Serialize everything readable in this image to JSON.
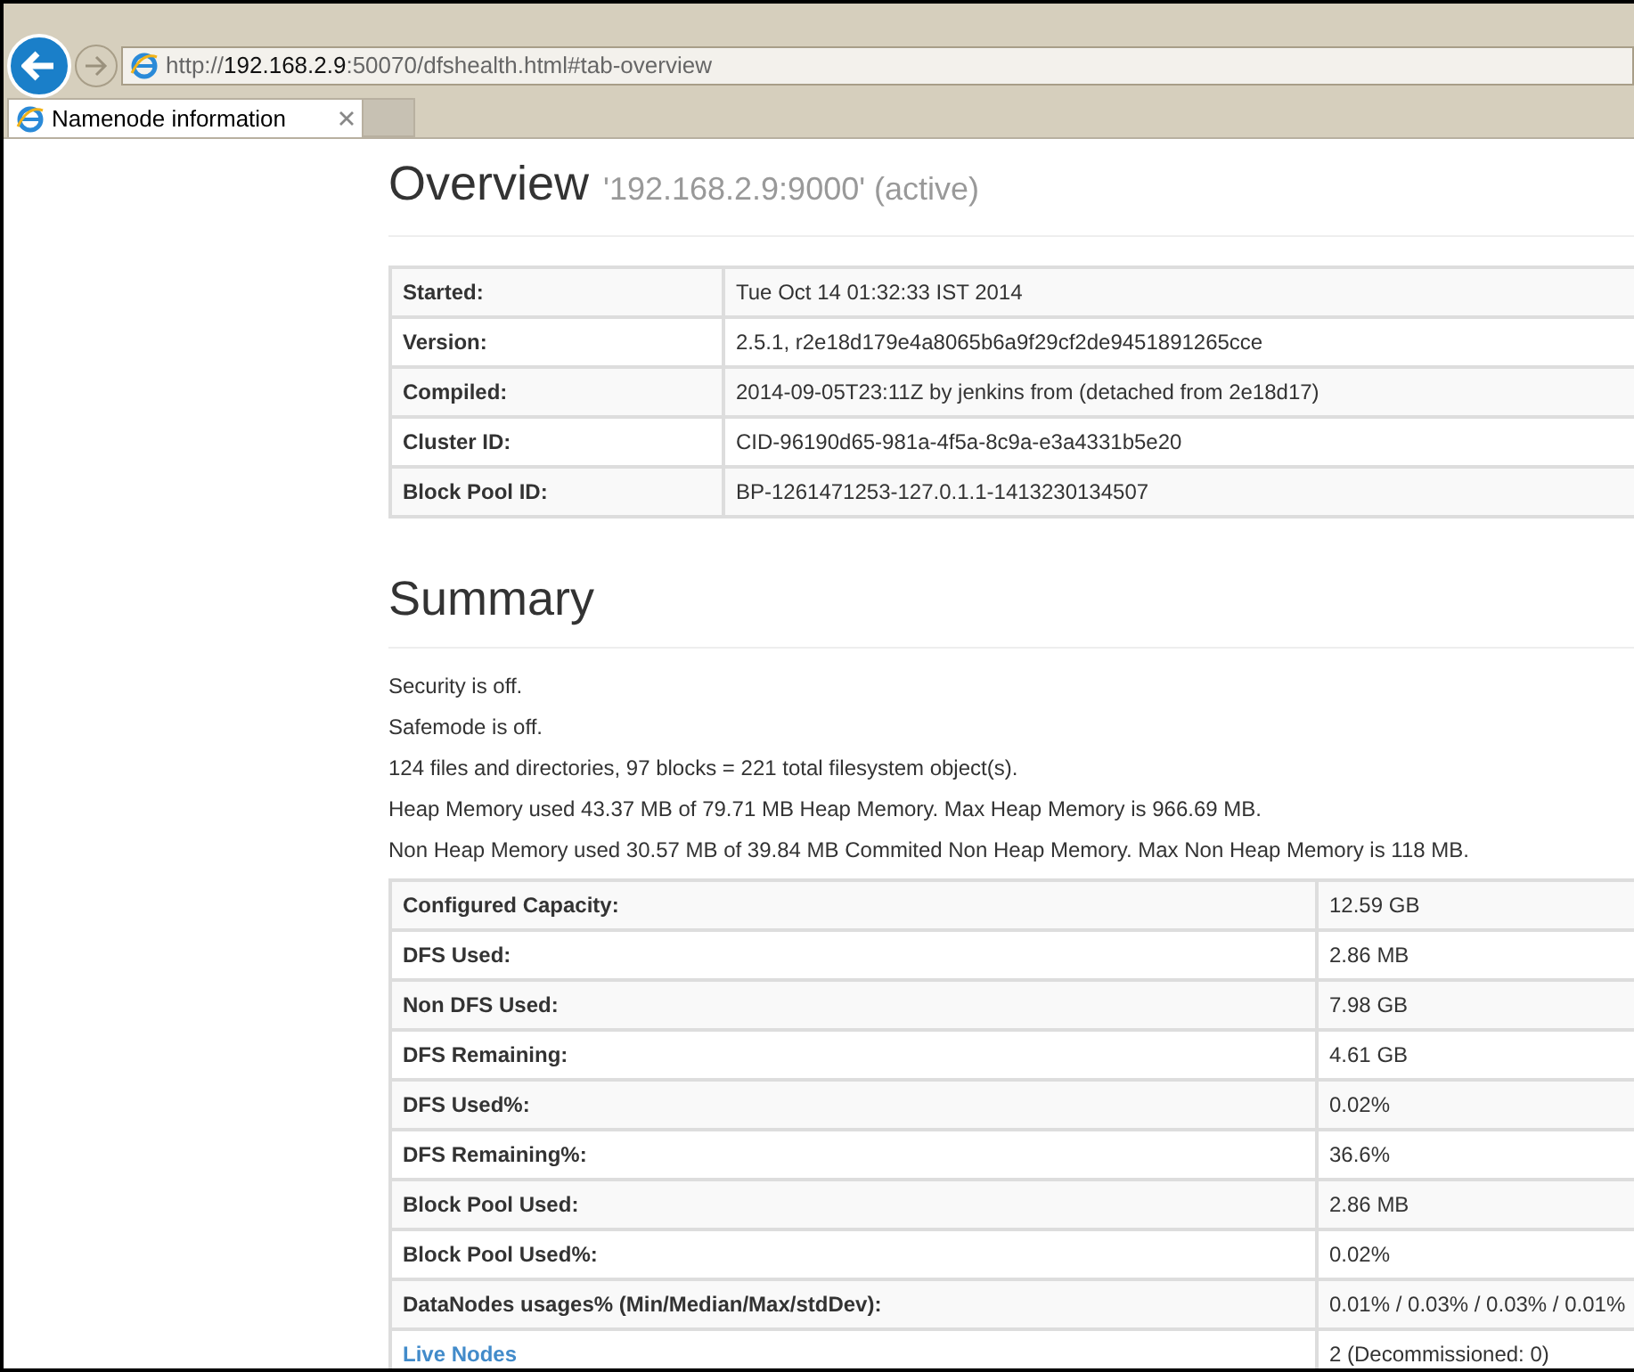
{
  "browser": {
    "address": {
      "scheme": "http://",
      "host": "192.168.2.9",
      "rest": ":50070/dfshealth.html#tab-overview"
    },
    "tabs": [
      {
        "label": "Namenode information",
        "selected": true
      }
    ]
  },
  "overview": {
    "title": "Overview",
    "subtitle": "'192.168.2.9:9000' (active)",
    "rows": [
      {
        "label": "Started:",
        "value": "Tue Oct 14 01:32:33 IST 2014"
      },
      {
        "label": "Version:",
        "value": "2.5.1, r2e18d179e4a8065b6a9f29cf2de9451891265cce"
      },
      {
        "label": "Compiled:",
        "value": "2014-09-05T23:11Z by jenkins from (detached from 2e18d17)"
      },
      {
        "label": "Cluster ID:",
        "value": "CID-96190d65-981a-4f5a-8c9a-e3a4331b5e20"
      },
      {
        "label": "Block Pool ID:",
        "value": "BP-1261471253-127.0.1.1-1413230134507"
      }
    ]
  },
  "summary": {
    "title": "Summary",
    "lines": [
      "Security is off.",
      "Safemode is off.",
      "124 files and directories, 97 blocks = 221 total filesystem object(s).",
      "Heap Memory used 43.37 MB of 79.71 MB Heap Memory. Max Heap Memory is 966.69 MB.",
      "Non Heap Memory used 30.57 MB of 39.84 MB Commited Non Heap Memory. Max Non Heap Memory is 118 MB."
    ],
    "rows": [
      {
        "kind": "text",
        "label": "Configured Capacity:",
        "value": "12.59 GB"
      },
      {
        "kind": "text",
        "label": "DFS Used:",
        "value": "2.86 MB"
      },
      {
        "kind": "text",
        "label": "Non DFS Used:",
        "value": "7.98 GB"
      },
      {
        "kind": "text",
        "label": "DFS Remaining:",
        "value": "4.61 GB"
      },
      {
        "kind": "text",
        "label": "DFS Used%:",
        "value": "0.02%"
      },
      {
        "kind": "text",
        "label": "DFS Remaining%:",
        "value": "36.6%"
      },
      {
        "kind": "text",
        "label": "Block Pool Used:",
        "value": "2.86 MB"
      },
      {
        "kind": "text",
        "label": "Block Pool Used%:",
        "value": "0.02%"
      },
      {
        "kind": "text",
        "label": "DataNodes usages% (Min/Median/Max/stdDev):",
        "value": "0.01% / 0.03% / 0.03% / 0.01%"
      },
      {
        "kind": "link",
        "label": "Live Nodes",
        "value": "2 (Decommissioned: 0)"
      }
    ]
  }
}
